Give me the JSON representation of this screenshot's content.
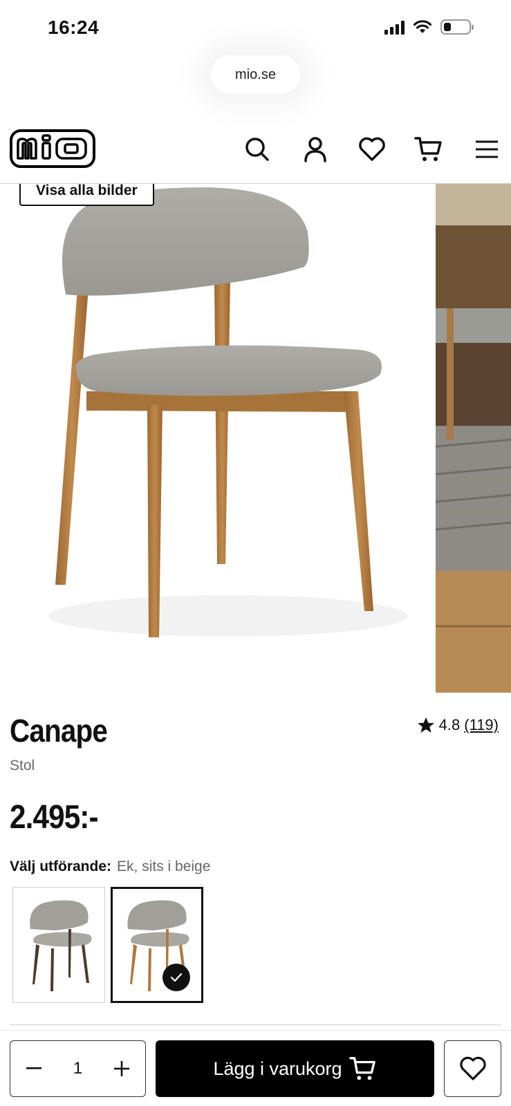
{
  "status_bar": {
    "time": "16:24",
    "battery_level": 0.25
  },
  "browser": {
    "url": "mio.se"
  },
  "header": {
    "logo_text": "mio",
    "icons": [
      "search-icon",
      "account-icon",
      "heart-icon",
      "cart-icon",
      "menu-icon"
    ]
  },
  "gallery": {
    "view_all_label": "Visa alla bilder"
  },
  "product": {
    "name": "Canape",
    "type": "Stol",
    "price": "2.495:-",
    "rating": "4.8",
    "review_count": "(119)"
  },
  "variant": {
    "label": "Välj utförande:",
    "selected": "Ek, sits i beige",
    "options": [
      "dark-wood",
      "oak"
    ],
    "selected_index": 1
  },
  "cart_bar": {
    "quantity": "1",
    "add_to_cart_label": "Lägg i varukorg"
  },
  "colors": {
    "accent": "#000000",
    "muted_text": "#666666",
    "fabric": "#a8a6a0",
    "oak": "#b07a3e"
  }
}
